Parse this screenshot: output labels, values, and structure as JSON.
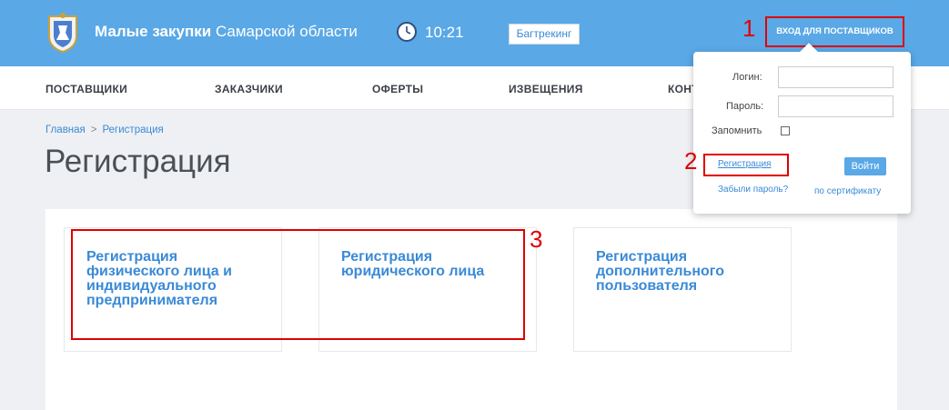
{
  "header": {
    "brand_bold": "Малые закупки",
    "brand_rest": "Самарской области",
    "time": "10:21",
    "bugtrack_label": "Багтрекинг",
    "login_label": "ВХОД ДЛЯ ПОСТАВЩИКОВ"
  },
  "nav": {
    "items": [
      "ПОСТАВЩИКИ",
      "ЗАКАЗЧИКИ",
      "ОФЕРТЫ",
      "ИЗВЕЩЕНИЯ",
      "КОНТ"
    ]
  },
  "breadcrumb": {
    "home": "Главная",
    "separator": ">",
    "current": "Регистрация"
  },
  "page_title": "Регистрация",
  "cards": [
    {
      "line1": "Регистрация",
      "line2": "физического лица и",
      "line3": "индивидуального",
      "line4": "предпринимателя"
    },
    {
      "line1": "Регистрация",
      "line2": "юридического лица"
    },
    {
      "line1": "Регистрация",
      "line2": "дополнительного",
      "line3": "пользователя"
    }
  ],
  "login_form": {
    "login_label": "Логин:",
    "password_label": "Пароль:",
    "remember_label": "Запомнить",
    "register_link": "Регистрация",
    "enter_button": "Войти",
    "forgot_link": "Забыли пароль?",
    "cert_link": "по сертификату"
  },
  "annotations": [
    "1",
    "2",
    "3"
  ],
  "colors": {
    "header_bg": "#5aa8e6",
    "accent": "#3a8ad6",
    "highlight": "#e00000"
  }
}
